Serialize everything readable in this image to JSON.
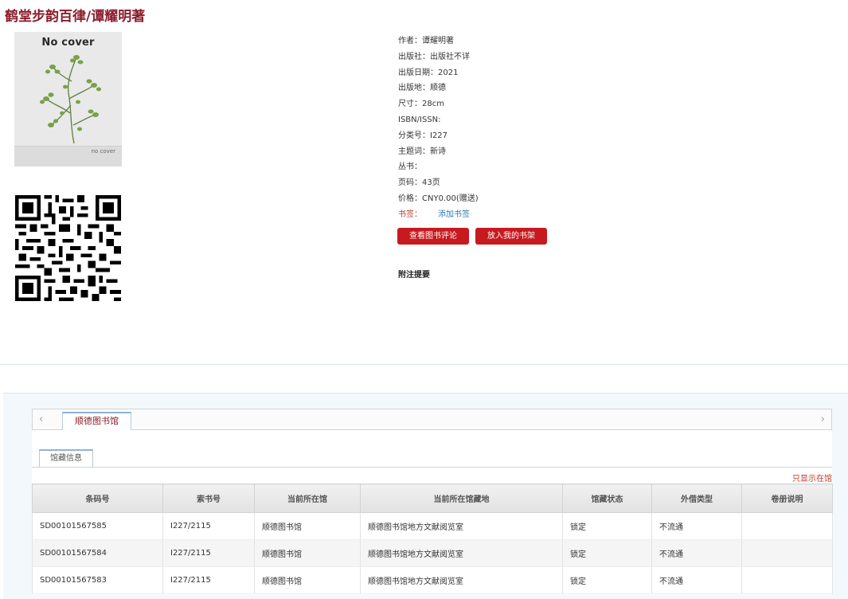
{
  "book": {
    "title": "鹤堂步韵百律/谭耀明著",
    "cover": {
      "top_text": "No cover",
      "bottom_text": "no cover"
    },
    "meta": [
      {
        "label": "作者：",
        "value": "谭耀明著"
      },
      {
        "label": "出版社：",
        "value": "出版社不详"
      },
      {
        "label": "出版日期：",
        "value": "2021"
      },
      {
        "label": "出版地：",
        "value": "顺德"
      },
      {
        "label": "尺寸：",
        "value": "28cm"
      },
      {
        "label": "ISBN/ISSN:",
        "value": ""
      },
      {
        "label": "分类号：",
        "value": "I227"
      },
      {
        "label": "主题词：",
        "value": "新诗"
      },
      {
        "label": "丛书：",
        "value": ""
      },
      {
        "label": "页码：",
        "value": "43页"
      },
      {
        "label": "价格：",
        "value": "CNY0.00(赠送)"
      }
    ],
    "bookmark_label": "书签：",
    "bookmark_link": "添加书签",
    "buttons": {
      "review": "查看图书评论",
      "shelf": "放入我的书架"
    },
    "note_title": "附注提要"
  },
  "holdings": {
    "library_tab": "顺德图书馆",
    "sub_tab": "馆藏信息",
    "only_available": "只显示在馆",
    "columns": [
      "条码号",
      "索书号",
      "当前所在馆",
      "当前所在馆藏地",
      "馆藏状态",
      "外借类型",
      "卷册说明"
    ],
    "rows": [
      [
        "SD00101567585",
        "I227/2115",
        "顺德图书馆",
        "顺德图书馆地方文献阅览室",
        "锁定",
        "不流通",
        ""
      ],
      [
        "SD00101567584",
        "I227/2115",
        "顺德图书馆",
        "顺德图书馆地方文献阅览室",
        "锁定",
        "不流通",
        ""
      ],
      [
        "SD00101567583",
        "I227/2115",
        "顺德图书馆",
        "顺德图书馆地方文献阅览室",
        "锁定",
        "不流通",
        ""
      ]
    ]
  },
  "icons": {
    "prev": "chevron-left-icon",
    "next": "chevron-right-icon"
  },
  "colors": {
    "accent": "#8b1c2c",
    "button": "#c8191f",
    "link": "#2a7bb5"
  }
}
